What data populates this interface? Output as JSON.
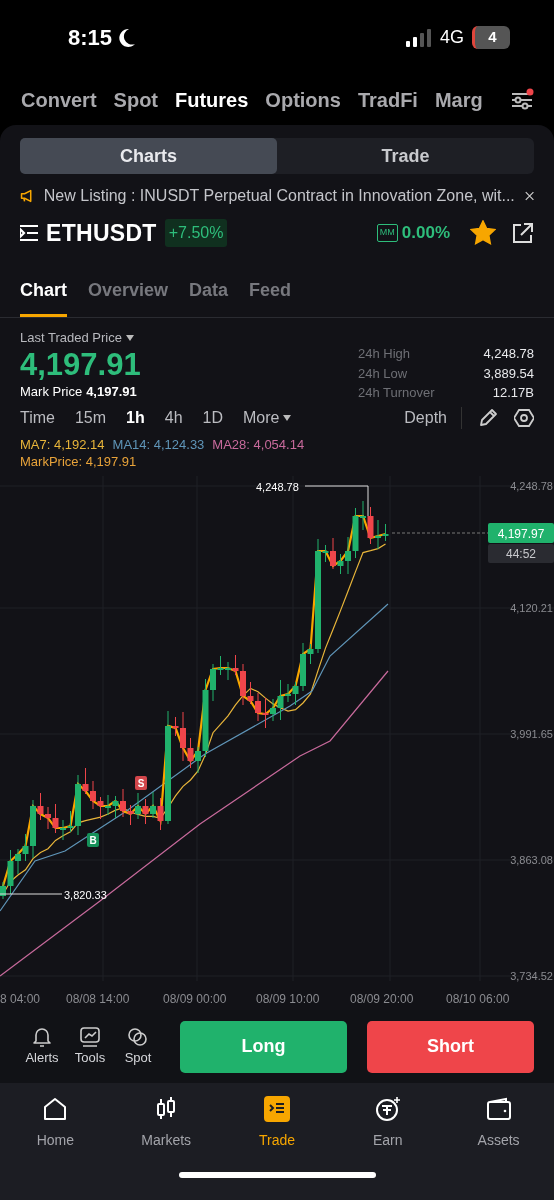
{
  "status_bar": {
    "time": "8:15",
    "network": "4G",
    "battery": "4"
  },
  "top_tabs": [
    {
      "label": "Convert",
      "selected": false
    },
    {
      "label": "Spot",
      "selected": false
    },
    {
      "label": "Futures",
      "selected": true
    },
    {
      "label": "Options",
      "selected": false
    },
    {
      "label": "TradFi",
      "selected": false
    },
    {
      "label": "Marg",
      "selected": false
    }
  ],
  "view_switch": [
    {
      "label": "Charts",
      "selected": true
    },
    {
      "label": "Trade",
      "selected": false
    }
  ],
  "banner": {
    "text": "New Listing : INUSDT Perpetual Contract in Innovation Zone, wit..."
  },
  "symbol": {
    "name": "ETHUSDT",
    "change": "+7.50%",
    "mm_badge": "MM",
    "mm_rate": "0.00%",
    "favorite": true
  },
  "sub_tabs": [
    {
      "label": "Chart",
      "selected": true
    },
    {
      "label": "Overview",
      "selected": false
    },
    {
      "label": "Data",
      "selected": false
    },
    {
      "label": "Feed",
      "selected": false
    }
  ],
  "price": {
    "label": "Last Traded Price",
    "last": "4,197.91",
    "mark_label": "Mark Price",
    "mark": "4,197.91"
  },
  "stats": [
    {
      "label": "24h High",
      "value": "4,248.78"
    },
    {
      "label": "24h Low",
      "value": "3,889.54"
    },
    {
      "label": "24h Turnover",
      "value": "12.17B"
    }
  ],
  "intervals": [
    {
      "label": "Time",
      "selected": false,
      "kind": "plain"
    },
    {
      "label": "15m",
      "selected": false,
      "kind": "plain"
    },
    {
      "label": "1h",
      "selected": true,
      "kind": "plain"
    },
    {
      "label": "4h",
      "selected": false,
      "kind": "plain"
    },
    {
      "label": "1D",
      "selected": false,
      "kind": "plain"
    },
    {
      "label": "More",
      "selected": false,
      "kind": "dropdown"
    }
  ],
  "depth": "Depth",
  "ma_legend": [
    {
      "label": "MA7: 4,192.14",
      "color": "#e8b53a"
    },
    {
      "label": "MA14: 4,124.33",
      "color": "#5f95b8"
    },
    {
      "label": "MA28: 4,054.14",
      "color": "#c86a9c"
    }
  ],
  "mark_legend": "MarkPrice: 4,197.91",
  "chart": {
    "y_labels": [
      "4,248.78",
      "4,120.21",
      "3,991.65",
      "3,863.08",
      "3,734.52"
    ],
    "x_labels": [
      "8 04:00",
      "08/08 14:00",
      "08/09 00:00",
      "08/09 10:00",
      "08/09 20:00",
      "08/10 06:00"
    ],
    "high_label": "4,248.78",
    "low_label": "3,820.33",
    "price_tag": "4,197.97",
    "countdown": "44:52",
    "signals": [
      {
        "text": "B",
        "kind": "buy"
      },
      {
        "text": "S",
        "kind": "sell"
      }
    ]
  },
  "tools": [
    {
      "label": "Alerts",
      "kind": "bell"
    },
    {
      "label": "Tools",
      "kind": "tools"
    },
    {
      "label": "Spot",
      "kind": "spot"
    }
  ],
  "long": "Long",
  "short": "Short",
  "nav": [
    {
      "label": "Home",
      "kind": "home",
      "selected": false
    },
    {
      "label": "Markets",
      "kind": "markets",
      "selected": false
    },
    {
      "label": "Trade",
      "kind": "trade",
      "selected": true
    },
    {
      "label": "Earn",
      "kind": "earn",
      "selected": false
    },
    {
      "label": "Assets",
      "kind": "assets",
      "selected": false
    }
  ]
}
